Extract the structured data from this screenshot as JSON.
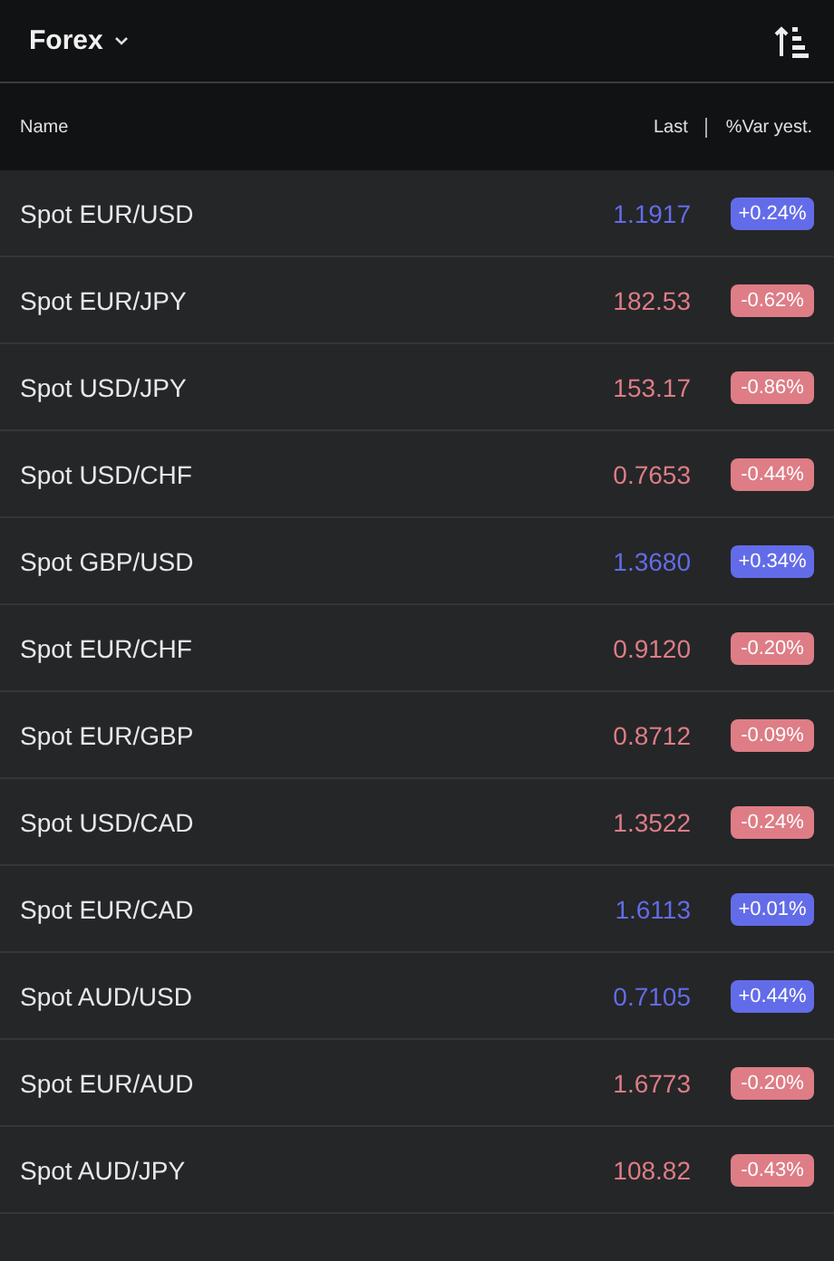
{
  "header": {
    "title": "Forex"
  },
  "columns": {
    "name": "Name",
    "last": "Last",
    "change": "%Var yest."
  },
  "rows": [
    {
      "name": "Spot EUR/USD",
      "last": "1.1917",
      "change": "+0.24%",
      "color": "#636ce8"
    },
    {
      "name": "Spot EUR/JPY",
      "last": "182.53",
      "change": "-0.62%",
      "color": "#de7d86"
    },
    {
      "name": "Spot USD/JPY",
      "last": "153.17",
      "change": "-0.86%",
      "color": "#de7d86"
    },
    {
      "name": "Spot USD/CHF",
      "last": "0.7653",
      "change": "-0.44%",
      "color": "#de7d86"
    },
    {
      "name": "Spot GBP/USD",
      "last": "1.3680",
      "change": "+0.34%",
      "color": "#636ce8"
    },
    {
      "name": "Spot EUR/CHF",
      "last": "0.9120",
      "change": "-0.20%",
      "color": "#de7d86"
    },
    {
      "name": "Spot EUR/GBP",
      "last": "0.8712",
      "change": "-0.09%",
      "color": "#de7d86"
    },
    {
      "name": "Spot USD/CAD",
      "last": "1.3522",
      "change": "-0.24%",
      "color": "#de7d86"
    },
    {
      "name": "Spot EUR/CAD",
      "last": "1.6113",
      "change": "+0.01%",
      "color": "#636ce8"
    },
    {
      "name": "Spot AUD/USD",
      "last": "0.7105",
      "change": "+0.44%",
      "color": "#636ce8"
    },
    {
      "name": "Spot EUR/AUD",
      "last": "1.6773",
      "change": "-0.20%",
      "color": "#de7d86"
    },
    {
      "name": "Spot AUD/JPY",
      "last": "108.82",
      "change": "-0.43%",
      "color": "#de7d86"
    }
  ]
}
